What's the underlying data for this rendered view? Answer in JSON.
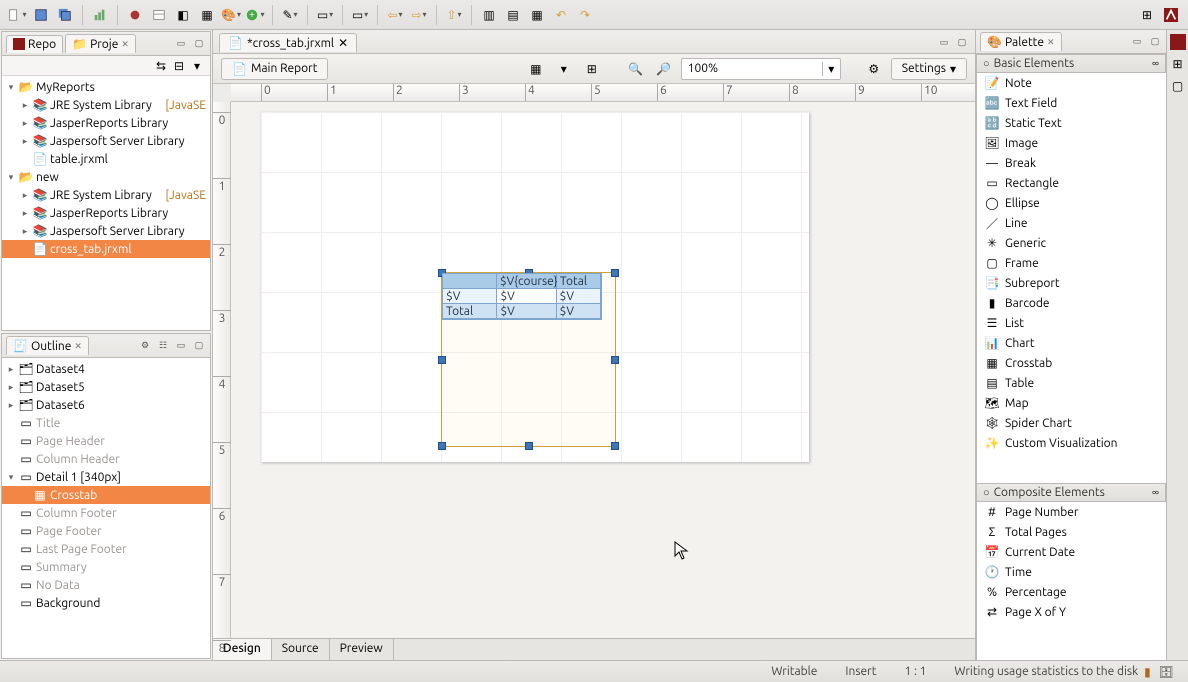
{
  "toolbar_icons": [
    "new",
    "save",
    "saveall",
    "sep",
    "chart",
    "sep",
    "bug",
    "table",
    "nav",
    "window",
    "palette",
    "plus",
    "sep",
    "wand",
    "sep",
    "box",
    "sep",
    "box2",
    "sep",
    "prev",
    "next",
    "sep",
    "up",
    "sep",
    "align1",
    "align2",
    "align3",
    "undo",
    "redo"
  ],
  "right_icons": [
    "persp",
    "logo"
  ],
  "left_upper": {
    "tabs": [
      "Repo",
      "Proje"
    ],
    "tree": [
      {
        "tw": "▾",
        "ic": "folder",
        "label": "MyReports",
        "ind": 0
      },
      {
        "tw": "▸",
        "ic": "lib",
        "label": "JRE System Library",
        "extra": "[JavaSE",
        "ind": 1
      },
      {
        "tw": "▸",
        "ic": "lib",
        "label": "JasperReports Library",
        "ind": 1
      },
      {
        "tw": "▸",
        "ic": "lib",
        "label": "Jaspersoft Server Library",
        "ind": 1
      },
      {
        "tw": "",
        "ic": "file",
        "label": "table.jrxml",
        "ind": 1
      },
      {
        "tw": "▾",
        "ic": "folder",
        "label": "new",
        "ind": 0
      },
      {
        "tw": "▸",
        "ic": "lib",
        "label": "JRE System Library",
        "extra": "[JavaSE",
        "ind": 1
      },
      {
        "tw": "▸",
        "ic": "lib",
        "label": "JasperReports Library",
        "ind": 1
      },
      {
        "tw": "▸",
        "ic": "lib",
        "label": "Jaspersoft Server Library",
        "ind": 1
      },
      {
        "tw": "",
        "ic": "file",
        "label": "cross_tab.jrxml",
        "ind": 1,
        "sel": true
      }
    ]
  },
  "outline": {
    "title": "Outline",
    "tree": [
      {
        "tw": "▸",
        "ic": "ds",
        "label": "Dataset4",
        "ind": 0
      },
      {
        "tw": "▸",
        "ic": "ds",
        "label": "Dataset5",
        "ind": 0
      },
      {
        "tw": "▸",
        "ic": "ds",
        "label": "Dataset6",
        "ind": 0
      },
      {
        "tw": "",
        "ic": "band",
        "label": "Title",
        "ind": 0,
        "dim": true
      },
      {
        "tw": "",
        "ic": "band",
        "label": "Page Header",
        "ind": 0,
        "dim": true
      },
      {
        "tw": "",
        "ic": "band",
        "label": "Column Header",
        "ind": 0,
        "dim": true
      },
      {
        "tw": "▾",
        "ic": "band",
        "label": "Detail 1 [340px]",
        "ind": 0
      },
      {
        "tw": "",
        "ic": "ct",
        "label": "Crosstab",
        "ind": 1,
        "sel": true
      },
      {
        "tw": "",
        "ic": "band",
        "label": "Column Footer",
        "ind": 0,
        "dim": true
      },
      {
        "tw": "",
        "ic": "band",
        "label": "Page Footer",
        "ind": 0,
        "dim": true
      },
      {
        "tw": "",
        "ic": "band",
        "label": "Last Page Footer",
        "ind": 0,
        "dim": true
      },
      {
        "tw": "",
        "ic": "band",
        "label": "Summary",
        "ind": 0,
        "dim": true
      },
      {
        "tw": "",
        "ic": "band",
        "label": "No Data",
        "ind": 0,
        "dim": true
      },
      {
        "tw": "",
        "ic": "band",
        "label": "Background",
        "ind": 0
      }
    ]
  },
  "editor": {
    "tab_label": "*cross_tab.jrxml",
    "main_report": "Main Report",
    "zoom": "100%",
    "settings": "Settings",
    "bottom_tabs": [
      "Design",
      "Source",
      "Preview"
    ],
    "crosstab": {
      "r0": [
        "",
        "$V{course}",
        "Total"
      ],
      "r1": [
        "$V",
        "$V",
        "$V"
      ],
      "r2": [
        "Total",
        "$V",
        "$V"
      ]
    }
  },
  "palette": {
    "title": "Palette",
    "section1": "Basic Elements",
    "items1": [
      "Note",
      "Text Field",
      "Static Text",
      "Image",
      "Break",
      "Rectangle",
      "Ellipse",
      "Line",
      "Generic",
      "Frame",
      "Subreport",
      "Barcode",
      "List",
      "Chart",
      "Crosstab",
      "Table",
      "Map",
      "Spider Chart",
      "Custom Visualization"
    ],
    "section2": "Composite Elements",
    "items2": [
      "Page Number",
      "Total Pages",
      "Current Date",
      "Time",
      "Percentage",
      "Page X of Y"
    ]
  },
  "status": {
    "writable": "Writable",
    "insert": "Insert",
    "pos": "1 : 1",
    "writing": "Writing usage statistics to the disk"
  }
}
